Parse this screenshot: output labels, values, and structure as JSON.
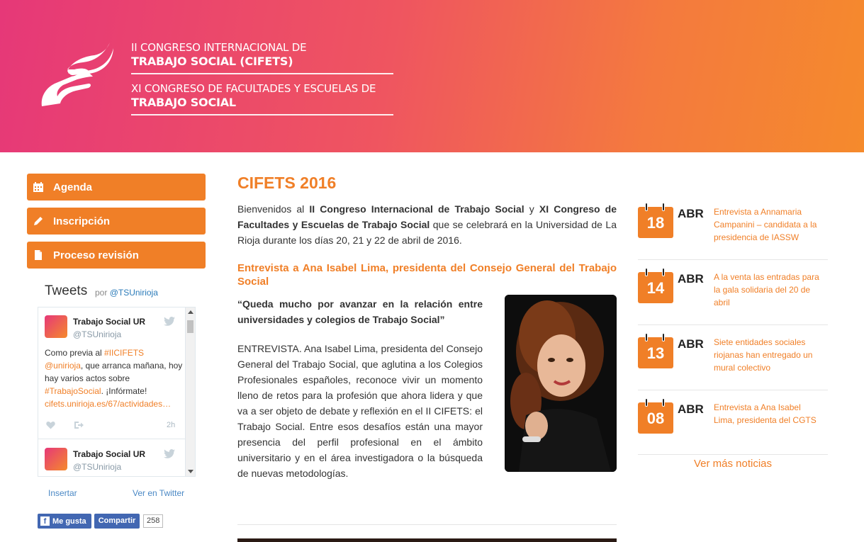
{
  "header": {
    "line1": "II CONGRESO INTERNACIONAL DE",
    "line2": "TRABAJO SOCIAL (CIFETS)",
    "line3": "XI CONGRESO DE FACULTADES Y ESCUELAS DE",
    "line4": "TRABAJO SOCIAL"
  },
  "nav": [
    {
      "label": "Agenda",
      "icon": "calendar-icon"
    },
    {
      "label": "Inscripción",
      "icon": "pencil-icon"
    },
    {
      "label": "Proceso revisión",
      "icon": "document-icon"
    }
  ],
  "tweets": {
    "title": "Tweets",
    "by": "por",
    "handle_link": "@TSUnirioja",
    "items": [
      {
        "name": "Trabajo Social UR",
        "handle": "@TSUnirioja",
        "text_1": "Como previa al ",
        "hashtag_1": "#IICIFETS",
        "mention": "@unirioja",
        "text_2": ", que arranca mañana, hoy hay varios actos sobre ",
        "hashtag_2": "#TrabajoSocial",
        "text_3": ". ¡Infórmate! ",
        "link": "cifets.unirioja.es/67/actividades…",
        "time": "2h"
      },
      {
        "name": "Trabajo Social UR",
        "handle": "@TSUnirioja"
      }
    ],
    "embed": "Insertar",
    "view": "Ver en Twitter"
  },
  "facebook": {
    "like": "Me gusta",
    "share": "Compartir",
    "count": "258"
  },
  "main": {
    "title": "CIFETS 2016",
    "intro_1": "Bienvenidos al ",
    "intro_b1": "II Congreso Internacional de Trabajo Social",
    "intro_2": " y ",
    "intro_b2": "XI Congreso de Facultades y Escuelas de Trabajo Social",
    "intro_3": " que se celebrará en la Universidad de La Rioja durante los días 20, 21 y 22 de abril de 2016.",
    "article_title": "Entrevista a Ana Isabel Lima, presidenta del Consejo General del Trabajo Social",
    "quote": "“Queda mucho por avanzar en la relación entre universidades y colegios de Trabajo Social”",
    "body": "ENTREVISTA. Ana Isabel Lima, presidenta del Consejo General del Trabajo Social, que aglutina a los Colegios Profesionales españoles, reconoce vivir un momento lleno de retos para la profesión que ahora lidera y que va a ser objeto de debate y reflexión en el II CIFETS: el Trabajo Social. Entre esos desafíos están una mayor presencia del perfil profesional en el ámbito universitario y en el área investigadora o la búsqueda de nuevas metodologías."
  },
  "news": [
    {
      "day": "18",
      "month": "ABR",
      "title": "Entrevista a Annamaria Campanini – candidata a la presidencia de IASSW"
    },
    {
      "day": "14",
      "month": "ABR",
      "title": "A la venta las entradas para la gala solidaria del 20 de abril"
    },
    {
      "day": "13",
      "month": "ABR",
      "title": "Siete entidades sociales riojanas han entregado un mural colectivo"
    },
    {
      "day": "08",
      "month": "ABR",
      "title": "Entrevista a Ana Isabel Lima, presidenta del CGTS"
    }
  ],
  "more_news": "Ver más noticias",
  "colors": {
    "accent": "#f07f27",
    "header_start": "#e63878",
    "header_end": "#f58a2c"
  }
}
